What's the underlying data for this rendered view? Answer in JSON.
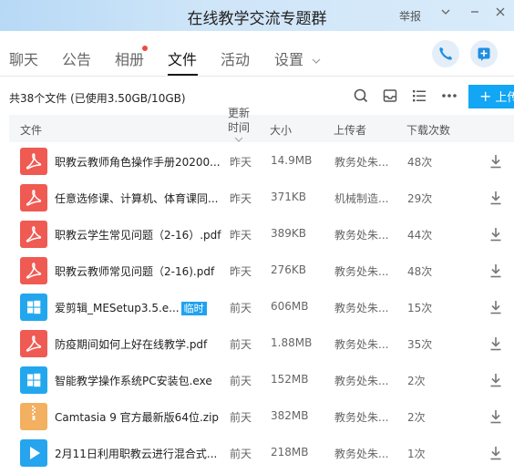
{
  "window": {
    "title": "在线教学交流专题群",
    "report_label": "举报"
  },
  "tabs": [
    {
      "label": "聊天"
    },
    {
      "label": "公告"
    },
    {
      "label": "相册"
    },
    {
      "label": "文件"
    },
    {
      "label": "活动"
    },
    {
      "label": "设置"
    }
  ],
  "active_tab": "文件",
  "toolbar": {
    "summary": "共38个文件 (已使用3.50GB/10GB)",
    "upload_label": "上传"
  },
  "table": {
    "headers": {
      "file": "文件",
      "updated": "更新\n时间",
      "size": "大小",
      "uploader": "上传者",
      "downloads": "下载次数"
    },
    "rows": [
      {
        "type": "pdf",
        "name": "职教云教师角色操作手册20200...",
        "time": "昨天",
        "size": "14.9MB",
        "uploader": "教务处朱...",
        "downloads": "48次"
      },
      {
        "type": "pdf",
        "name": "任意选修课、计算机、体育课同...",
        "time": "昨天",
        "size": "371KB",
        "uploader": "机械制造...",
        "downloads": "29次"
      },
      {
        "type": "pdf",
        "name": "职教云学生常见问题（2-16）.pdf",
        "time": "昨天",
        "size": "389KB",
        "uploader": "教务处朱...",
        "downloads": "44次"
      },
      {
        "type": "pdf",
        "name": "职教云教师常见问题（2-16).pdf",
        "time": "昨天",
        "size": "276KB",
        "uploader": "教务处朱...",
        "downloads": "48次"
      },
      {
        "type": "exe",
        "name": "爱剪辑_MESetup3.5.e...",
        "tag": "临时",
        "time": "前天",
        "size": "606MB",
        "uploader": "教务处朱...",
        "downloads": "15次"
      },
      {
        "type": "pdf",
        "name": "防疫期间如何上好在线教学.pdf",
        "time": "前天",
        "size": "1.88MB",
        "uploader": "教务处朱...",
        "downloads": "35次"
      },
      {
        "type": "exe",
        "name": "智能教学操作系统PC安装包.exe",
        "time": "前天",
        "size": "152MB",
        "uploader": "教务处朱...",
        "downloads": "2次"
      },
      {
        "type": "zip",
        "name": "Camtasia 9 官方最新版64位.zip",
        "time": "前天",
        "size": "382MB",
        "uploader": "教务处朱...",
        "downloads": "2次"
      },
      {
        "type": "vid",
        "name": "2月11日利用职教云进行混合式...",
        "time": "前天",
        "size": "218MB",
        "uploader": "教务处朱...",
        "downloads": "1次"
      }
    ]
  },
  "colors": {
    "accent": "#12a6f5",
    "pdf": "#ef5a52",
    "exe": "#22a7ee",
    "zip": "#f2b060",
    "notify_dot": "#f04a3e"
  },
  "icons": [
    "phone-icon",
    "add-app-icon",
    "search-icon",
    "inbox-icon",
    "list-view-icon",
    "more-icon",
    "download-icon",
    "pin-icon",
    "close-icon",
    "chevron-down-icon"
  ]
}
